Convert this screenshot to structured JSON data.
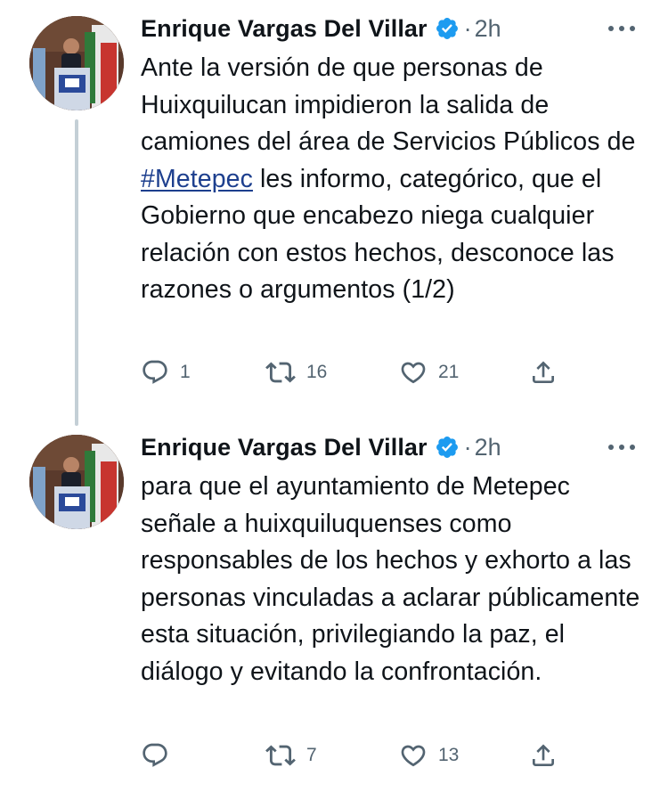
{
  "tweets": [
    {
      "author": "Enrique Vargas Del Villar",
      "separator": "·",
      "time": "2h",
      "text_before": "Ante la versión de que personas de Huixquilucan impidieron la salida de camiones del área de Servicios Públicos de ",
      "hashtag": "#Metepec",
      "text_after": " les informo, categórico, que el Gobierno que encabezo niega cualquier relación con estos hechos, desconoce las razones o argumentos (1/2)",
      "replies": "1",
      "retweets": "16",
      "likes": "21"
    },
    {
      "author": "Enrique Vargas Del Villar",
      "separator": "·",
      "time": "2h",
      "text": "para que el ayuntamiento de Metepec señale a huixquiluquenses como responsables de los hechos y exhorto a las personas vinculadas a aclarar públicamente esta situación, privilegiando la paz, el diálogo y evitando la confrontación.",
      "replies": "",
      "retweets": "7",
      "likes": "13"
    }
  ],
  "colors": {
    "text": "#0f1419",
    "secondary": "#536471",
    "hashtag": "#1d3f8e",
    "verified": "#1d9bf0",
    "thread_line": "#c4cfd6"
  },
  "icons": {
    "verified": "verified-badge-icon",
    "more": "more-options-icon",
    "reply": "reply-icon",
    "retweet": "retweet-icon",
    "like": "heart-icon",
    "share": "share-icon"
  }
}
